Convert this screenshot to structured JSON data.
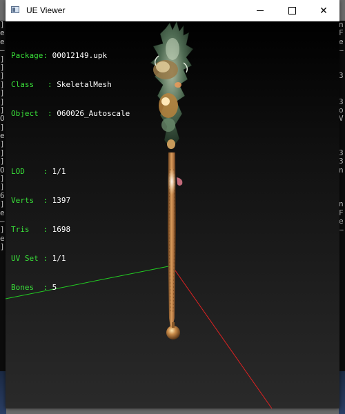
{
  "window": {
    "title": "UE Viewer"
  },
  "overlay": {
    "info": [
      {
        "label": "Package: ",
        "value": "00012149.upk"
      },
      {
        "label": "Class   : ",
        "value": "SkeletalMesh"
      },
      {
        "label": "Object  : ",
        "value": "060026_Autoscale"
      }
    ],
    "stats": [
      {
        "label": "LOD    : ",
        "value": "1/1"
      },
      {
        "label": "Verts  : ",
        "value": "1397"
      },
      {
        "label": "Tris   : ",
        "value": "1698"
      },
      {
        "label": "UV Set : ",
        "value": "1/1"
      },
      {
        "label": "Bones  : ",
        "value": "5"
      }
    ]
  },
  "background_console": {
    "left_chars": [
      "]",
      "e",
      "e",
      "—",
      "]",
      "]",
      "]",
      "]",
      "]",
      "]",
      "]",
      "O",
      "]",
      "e",
      "]",
      "]",
      "]",
      "O",
      "]",
      "]",
      "6",
      "]",
      "e",
      "—",
      "]",
      "e",
      "]"
    ],
    "right_chars": [
      "n",
      "F",
      "e",
      "—",
      "",
      "",
      "3",
      "",
      "",
      "3",
      "o",
      "V",
      "",
      "",
      "",
      "3",
      "3",
      "n",
      "",
      "",
      "",
      "n",
      "F",
      "e",
      "—",
      "",
      ""
    ]
  },
  "colors": {
    "label_green": "#39e039",
    "axis_green": "#22cc22",
    "axis_red": "#dd2222",
    "titlebar": "#ffffff",
    "viewport": "#000000"
  },
  "scene": {
    "object": "staff-mesh",
    "axes": [
      "x-axis-red",
      "y-axis-green"
    ]
  }
}
